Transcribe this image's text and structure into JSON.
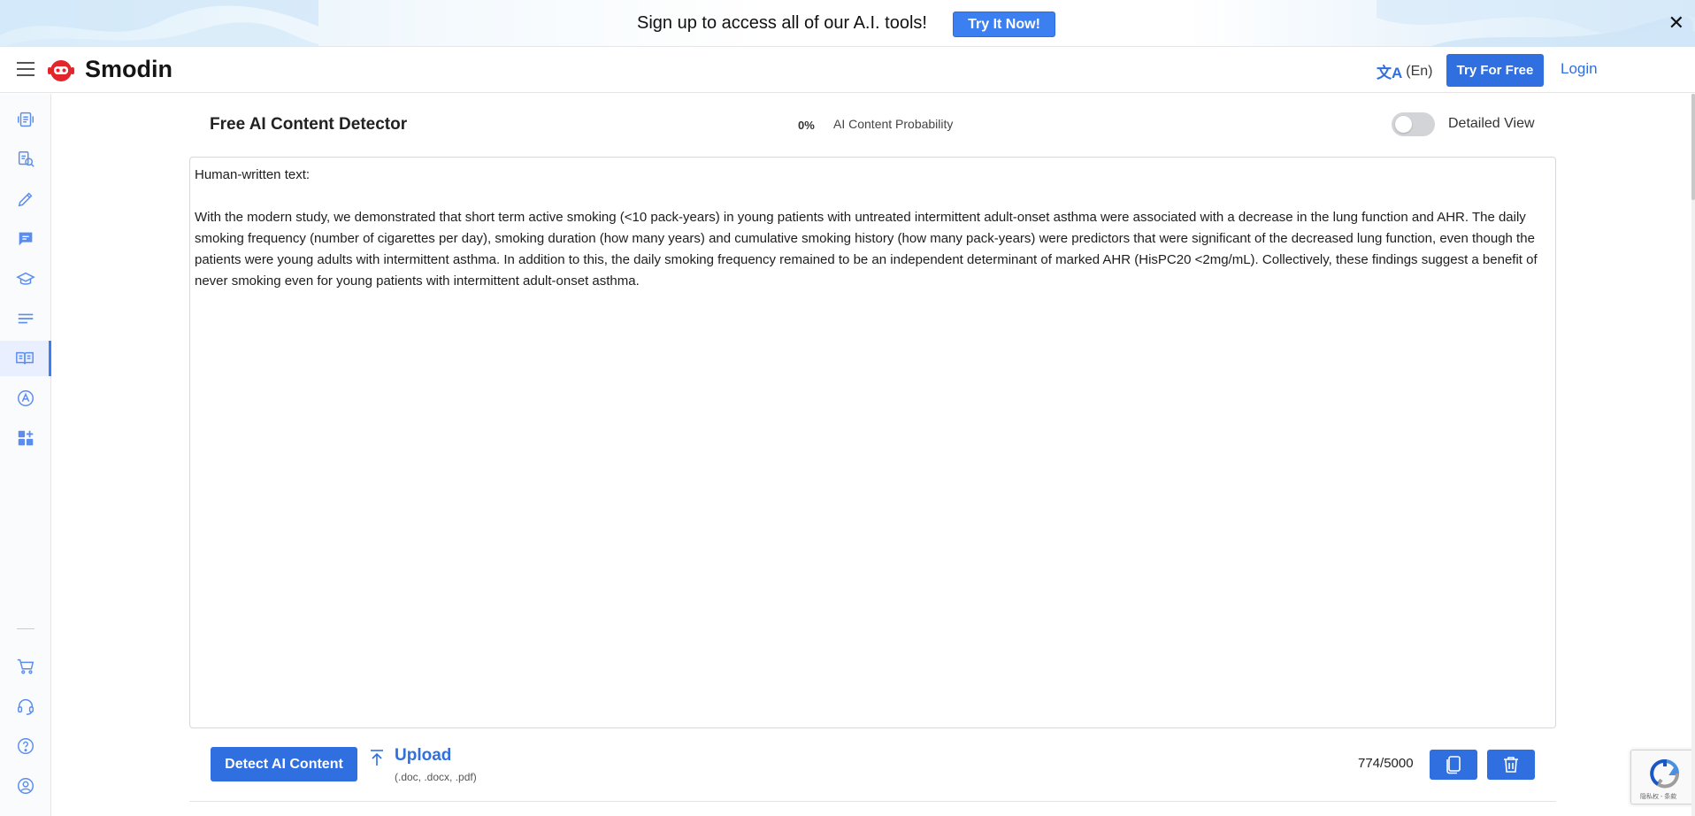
{
  "promo": {
    "text": "Sign up to access all of our A.I. tools!",
    "button_label": "Try It Now!",
    "close_glyph": "✕"
  },
  "header": {
    "brand": "Smodin",
    "language": "(En)",
    "try_free_label": "Try For Free",
    "login_label": "Login"
  },
  "sidebar": {
    "items": [
      {
        "icon": "rewriter-icon"
      },
      {
        "icon": "plagiarism-icon"
      },
      {
        "icon": "writer-icon"
      },
      {
        "icon": "chat-icon"
      },
      {
        "icon": "grader-icon"
      },
      {
        "icon": "summarizer-icon"
      },
      {
        "icon": "ai-detector-icon",
        "active": true
      },
      {
        "icon": "translator-icon"
      },
      {
        "icon": "more-apps-icon"
      },
      {
        "icon": "cart-icon"
      },
      {
        "icon": "support-icon"
      },
      {
        "icon": "help-icon"
      },
      {
        "icon": "account-icon"
      }
    ]
  },
  "tool": {
    "title": "Free AI Content Detector",
    "probability_value": "0%",
    "probability_label": "AI Content Probability",
    "detailed_view_label": "Detailed View",
    "detailed_view_on": false
  },
  "editor": {
    "heading_line": "Human-written text:",
    "body": "With the modern study, we demonstrated that short term active smoking (<10 pack-years) in young patients with untreated intermittent adult-onset asthma were associated with a decrease in the lung function and AHR. The daily smoking frequency (number of cigarettes per day), smoking duration (how many years) and cumulative smoking history (how many pack-years) were predictors that were significant of the decreased lung function, even though the patients were young adults with intermittent asthma. In addition to this, the daily smoking frequency remained to be an independent determinant of marked AHR (HisPC20 <2mg/mL). Collectively, these findings suggest a benefit of never smoking even for young patients with intermittent adult-onset asthma."
  },
  "actions": {
    "detect_label": "Detect AI Content",
    "upload_label": "Upload",
    "upload_hint": "(.doc, .docx, .pdf)",
    "char_count": "774/5000"
  },
  "recaptcha": {
    "text": "隐私权 - 条款"
  },
  "colors": {
    "primary": "#2f6fe0",
    "brand_red": "#e3262b"
  }
}
